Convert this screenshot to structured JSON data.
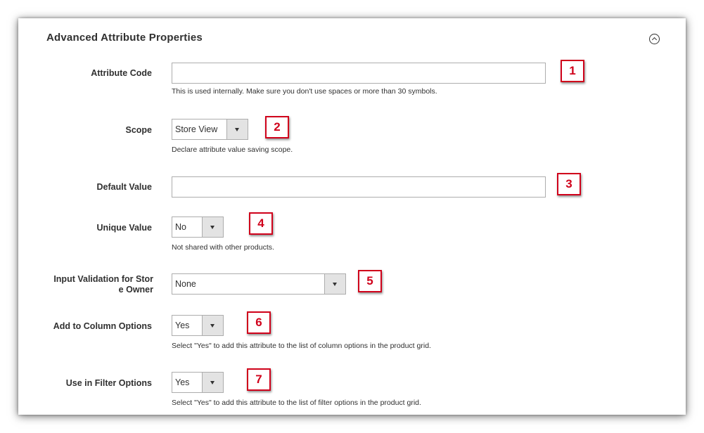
{
  "section": {
    "title": "Advanced Attribute Properties"
  },
  "fields": {
    "attribute_code": {
      "label": "Attribute Code",
      "value": "",
      "note": "This is used internally. Make sure you don't use spaces or more than 30 symbols.",
      "badge": "1"
    },
    "scope": {
      "label": "Scope",
      "value": "Store View",
      "note": "Declare attribute value saving scope.",
      "badge": "2"
    },
    "default_value": {
      "label": "Default Value",
      "value": "",
      "badge": "3"
    },
    "unique_value": {
      "label": "Unique Value",
      "value": "No",
      "note": "Not shared with other products.",
      "badge": "4"
    },
    "input_validation": {
      "label_line1": "Input Validation for Stor",
      "label_line2": "e Owner",
      "value": "None",
      "badge": "5"
    },
    "add_to_column_options": {
      "label": "Add to Column Options",
      "value": "Yes",
      "note": "Select \"Yes\" to add this attribute to the list of column options in the product grid.",
      "badge": "6"
    },
    "use_in_filter_options": {
      "label": "Use in Filter Options",
      "value": "Yes",
      "note": "Select \"Yes\" to add this attribute to the list of filter options in the product grid.",
      "badge": "7"
    }
  },
  "colors": {
    "badge_red": "#d0021b",
    "text": "#303030",
    "border": "#adadad",
    "select_arrow_bg": "#e3e3e3"
  },
  "icons": {
    "collapse": "chevron-up-circle-icon",
    "select_arrow": "triangle-down-icon"
  }
}
